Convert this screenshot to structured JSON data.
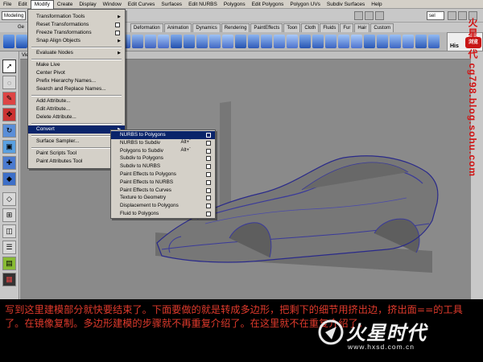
{
  "menubar": {
    "items": [
      "File",
      "Edit",
      "Modify",
      "Create",
      "Display",
      "Window",
      "Edit Curves",
      "Surfaces",
      "Edit NURBS",
      "Polygons",
      "Edit Polygons",
      "Polygon UVs",
      "Subdiv Surfaces",
      "Help"
    ],
    "active": "Modify"
  },
  "statusline": {
    "mode": "Modeling",
    "select_label": "sel"
  },
  "shelf": {
    "first_tab": "Ge",
    "tabs": [
      "Deformation",
      "Animation",
      "Dynamics",
      "Rendering",
      "PaintEffects",
      "Toon",
      "Cloth",
      "Fluids",
      "Fur",
      "Hair",
      "Custom"
    ],
    "history_label": "His"
  },
  "viewport": {
    "label": "Vie"
  },
  "modify_menu": {
    "items": [
      {
        "label": "Transformation Tools",
        "submenu": true
      },
      {
        "label": "Reset Transformations",
        "option": true
      },
      {
        "label": "Freeze Transformations",
        "option": true
      },
      {
        "label": "Snap Align Objects",
        "submenu": true
      },
      {
        "sep": true
      },
      {
        "label": "Evaluate Nodes",
        "submenu": true
      },
      {
        "sep": true
      },
      {
        "label": "Make Live"
      },
      {
        "label": "Center Pivot"
      },
      {
        "label": "Prefix Hierarchy Names..."
      },
      {
        "label": "Search and Replace Names..."
      },
      {
        "sep": true
      },
      {
        "label": "Add Attribute..."
      },
      {
        "label": "Edit Attribute..."
      },
      {
        "label": "Delete Attribute..."
      },
      {
        "sep": true
      },
      {
        "label": "Convert",
        "submenu": true,
        "highlight": true
      },
      {
        "sep": true
      },
      {
        "label": "Surface Sampler..."
      },
      {
        "sep": true
      },
      {
        "label": "Paint Scripts Tool",
        "option": true
      },
      {
        "label": "Paint Attributes Tool",
        "option": true
      }
    ]
  },
  "convert_menu": {
    "items": [
      {
        "label": "NURBS to Polygons",
        "option": true,
        "highlight": true
      },
      {
        "label": "NURBS to Subdiv",
        "option": true,
        "hotkey": "Alt+`"
      },
      {
        "label": "Polygons to Subdiv",
        "option": true,
        "hotkey": "Alt+`"
      },
      {
        "label": "Subdiv to Polygons",
        "option": true
      },
      {
        "label": "Subdiv to NURBS",
        "option": true
      },
      {
        "label": "Paint Effects to Polygons",
        "option": true
      },
      {
        "label": "Paint Effects to NURBS",
        "option": true
      },
      {
        "label": "Paint Effects to Curves",
        "option": true
      },
      {
        "label": "Texture to Geometry",
        "option": true
      },
      {
        "label": "Displacement to Polygons",
        "option": true
      },
      {
        "label": "Fluid to Polygons",
        "option": true
      }
    ]
  },
  "watermark": {
    "vertical": "火星时代 cg798.blog.sohu.com",
    "stamp": "浏览"
  },
  "caption": "写到这里建模部分就快要结束了。下面要做的就是转成多边形，把剩下的细节用挤出边，挤出面==的工具了。在镜像复制。多边形建模的步骤就不再重复介绍了。在这里就不在重复介绍了。",
  "logo": {
    "text": "火星时代",
    "url": "www.hxsd.com.cn"
  },
  "colors": {
    "menu_highlight": "#0a246a",
    "caption_red": "#e03a2c",
    "watermark_red": "#d21414"
  }
}
